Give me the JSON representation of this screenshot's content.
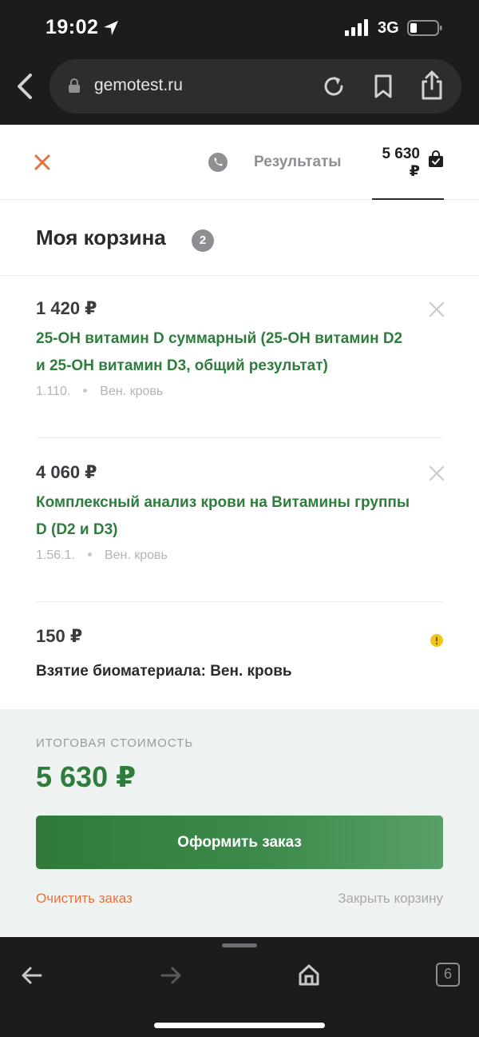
{
  "status_bar": {
    "time": "19:02",
    "network": "3G"
  },
  "browser": {
    "url": "gemotest.ru"
  },
  "header": {
    "results_label": "Результаты",
    "cart_amount": "5 630 ₽"
  },
  "cart": {
    "title": "Моя корзина",
    "count": "2",
    "items": [
      {
        "price": "1 420 ₽",
        "name": "25-ОН витамин D суммарный (25-OH витамин D2 и 25-OH витамин D3, общий результат)",
        "code": "1.110.",
        "material": "Вен. кровь"
      },
      {
        "price": "4 060 ₽",
        "name": "Комплексный анализ крови на Витамины группы D (D2 и D3)",
        "code": "1.56.1.",
        "material": "Вен. кровь"
      },
      {
        "price": "150 ₽",
        "name": "Взятие биоматериала: Вен. кровь"
      }
    ]
  },
  "summary": {
    "label": "ИТОГОВАЯ СТОИМОСТЬ",
    "total": "5 630 ₽",
    "checkout_label": "Оформить заказ",
    "clear_label": "Очистить заказ",
    "close_label": "Закрыть корзину"
  },
  "toolbar": {
    "tabs_count": "6"
  },
  "colors": {
    "accent_green": "#2e7d3c",
    "accent_orange": "#e0733f",
    "warning_yellow": "#f0c419",
    "chrome_dark": "#1c1c1e"
  }
}
